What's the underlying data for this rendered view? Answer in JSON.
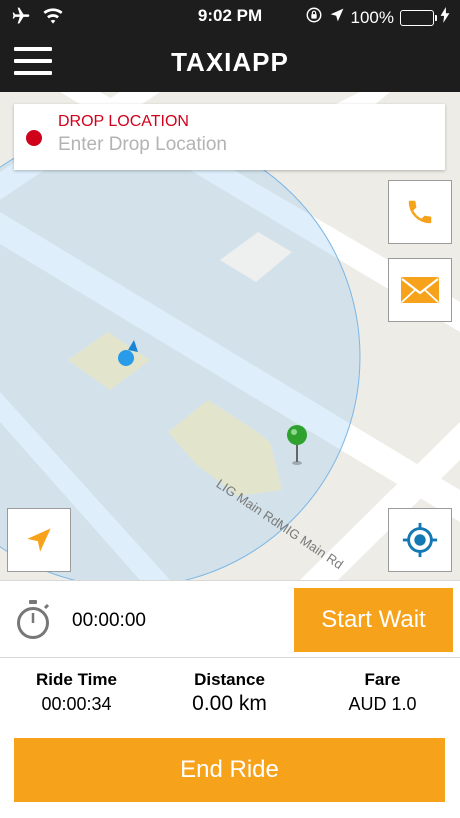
{
  "status_bar": {
    "time": "9:02 PM",
    "battery_text": "100%",
    "icons": [
      "airplane-icon",
      "wifi-icon",
      "rotation-lock-icon",
      "location-arrow-icon",
      "battery-icon",
      "charging-bolt-icon"
    ],
    "battery_level_percent": 100,
    "battery_color": "#4cd964"
  },
  "nav": {
    "title": "TAXIAPP",
    "menu_icon": "hamburger-menu-icon"
  },
  "drop": {
    "label": "DROP LOCATION",
    "placeholder": "Enter Drop Location",
    "value": "",
    "dot_color": "#d0011b"
  },
  "map": {
    "road_label": "LIG Main RdMIG Main Rd",
    "buttons": [
      "phone-icon",
      "mail-icon",
      "navigation-arrow-icon",
      "locate-target-icon"
    ]
  },
  "wait": {
    "timer": "00:00:00",
    "start_label": "Start Wait"
  },
  "stats": {
    "ride_time_label": "Ride Time",
    "ride_time_value": "00:00:34",
    "distance_label": "Distance",
    "distance_value": "0.00 km",
    "fare_label": "Fare",
    "fare_value": "AUD 1.0"
  },
  "actions": {
    "end_ride_label": "End Ride"
  },
  "colors": {
    "accent": "#f7a21b",
    "header": "#1d1d1d",
    "drop_red": "#d0011b",
    "icon_blue": "#1478b4"
  }
}
